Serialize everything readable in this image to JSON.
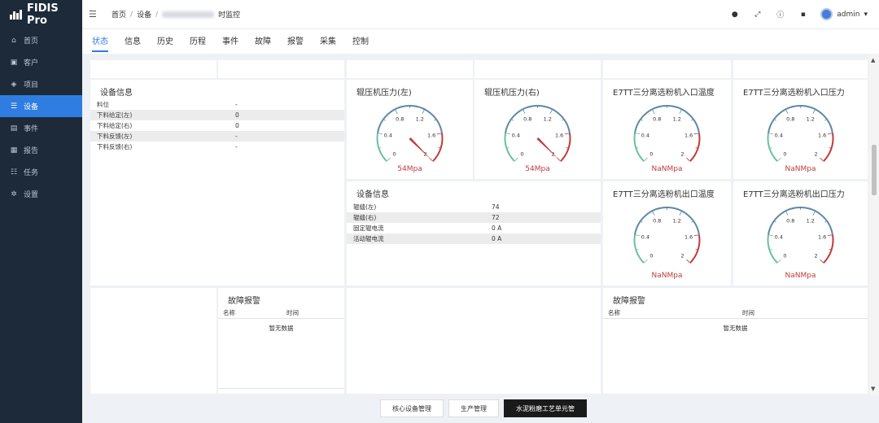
{
  "app": {
    "name": "FIDIS Pro"
  },
  "sidebar": {
    "items": [
      {
        "label": "首页",
        "icon": "home-icon",
        "glyph": "⌂",
        "active": false
      },
      {
        "label": "客户",
        "icon": "customer-icon",
        "glyph": "▣",
        "active": false
      },
      {
        "label": "项目",
        "icon": "project-icon",
        "glyph": "◈",
        "active": false
      },
      {
        "label": "设备",
        "icon": "device-icon",
        "glyph": "☰",
        "active": true
      },
      {
        "label": "事件",
        "icon": "event-icon",
        "glyph": "▤",
        "active": false
      },
      {
        "label": "报告",
        "icon": "report-icon",
        "glyph": "▦",
        "active": false
      },
      {
        "label": "任务",
        "icon": "task-icon",
        "glyph": "☷",
        "active": false
      },
      {
        "label": "设置",
        "icon": "settings-icon",
        "glyph": "✲",
        "active": false
      }
    ]
  },
  "header": {
    "breadcrumb": [
      "首页",
      "设备"
    ],
    "breadcrumb_suffix": "时监控",
    "user": "admin"
  },
  "tabs": [
    "状态",
    "信息",
    "历史",
    "历程",
    "事件",
    "故障",
    "报警",
    "采集",
    "控制"
  ],
  "active_tab": 0,
  "left_info": {
    "title": "设备信息",
    "rows": [
      {
        "k": "料位",
        "v": "-"
      },
      {
        "k": "下料给定(左)",
        "v": "0"
      },
      {
        "k": "下料给定(右)",
        "v": "0"
      },
      {
        "k": "下料反馈(左)",
        "v": "-"
      },
      {
        "k": "下料反馈(右)",
        "v": "-"
      }
    ]
  },
  "mid_info": {
    "title": "设备信息",
    "rows": [
      {
        "k": "辊缝(左)",
        "v": "74"
      },
      {
        "k": "辊缝(右)",
        "v": "72"
      },
      {
        "k": "固定辊电流",
        "v": "0 A"
      },
      {
        "k": "活动辊电流",
        "v": "0 A"
      }
    ]
  },
  "gauges": [
    {
      "title": "辊压机压力(左)",
      "value_text": "54Mpa",
      "value": 54,
      "max": 2,
      "ticks": [
        "0",
        "0.4",
        "0.8",
        "1.2",
        "1.6",
        "2"
      ]
    },
    {
      "title": "辊压机压力(右)",
      "value_text": "54Mpa",
      "value": 54,
      "max": 2,
      "ticks": [
        "0",
        "0.4",
        "0.8",
        "1.2",
        "1.6",
        "2"
      ]
    },
    {
      "title": "E7TT三分离选粉机入口温度",
      "value_text": "NaNMpa",
      "value": null,
      "max": 2,
      "ticks": [
        "0",
        "0.4",
        "0.8",
        "1.2",
        "1.6",
        "2"
      ]
    },
    {
      "title": "E7TT三分离选粉机入口压力",
      "value_text": "NaNMpa",
      "value": null,
      "max": 2,
      "ticks": [
        "0",
        "0.4",
        "0.8",
        "1.2",
        "1.6",
        "2"
      ]
    },
    {
      "title": "E7TT三分离选粉机出口温度",
      "value_text": "NaNMpa",
      "value": null,
      "max": 2,
      "ticks": [
        "0",
        "0.4",
        "0.8",
        "1.2",
        "1.6",
        "2"
      ]
    },
    {
      "title": "E7TT三分离选粉机出口压力",
      "value_text": "NaNMpa",
      "value": null,
      "max": 2,
      "ticks": [
        "0",
        "0.4",
        "0.8",
        "1.2",
        "1.6",
        "2"
      ]
    }
  ],
  "alarms": [
    {
      "title": "故障报警",
      "col_name": "名称",
      "col_time": "时间",
      "empty": "暂无数据"
    },
    {
      "title": "故障报警",
      "col_name": "名称",
      "col_time": "时间",
      "empty": "暂无数据"
    }
  ],
  "bottom_buttons": [
    "核心设备管理",
    "生产管理",
    "水泥粉磨工艺单元管"
  ],
  "active_bottom": 2,
  "colors": {
    "accent": "#2f7de1",
    "gauge_green": "#6cbfa0",
    "gauge_blue": "#5e88a8",
    "gauge_red": "#c23b3b"
  }
}
